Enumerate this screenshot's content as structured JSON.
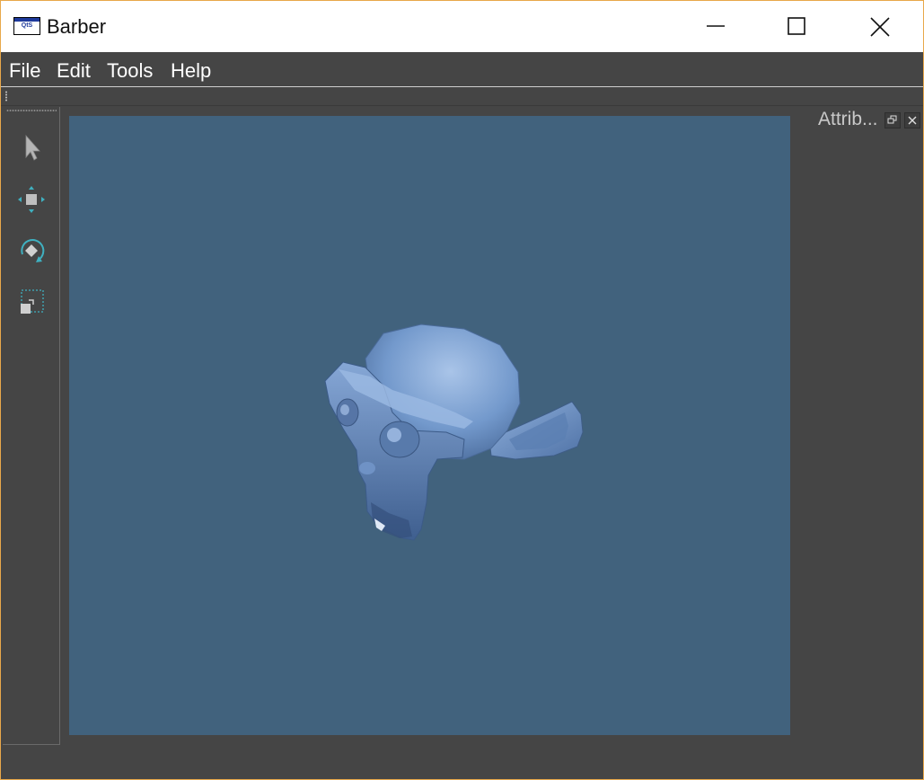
{
  "window": {
    "title": "Barber",
    "app_icon_text": "QtS"
  },
  "menu": {
    "items": [
      {
        "label": "File"
      },
      {
        "label": "Edit"
      },
      {
        "label": "Tools"
      },
      {
        "label": "Help"
      }
    ]
  },
  "tools": [
    {
      "icon": "select-arrow-icon"
    },
    {
      "icon": "move-icon"
    },
    {
      "icon": "rotate-icon"
    },
    {
      "icon": "scale-icon"
    }
  ],
  "attributes_dock": {
    "title": "Attrib..."
  },
  "colors": {
    "window_frame": "#e8a84a",
    "background": "#454545",
    "viewport": "#41627d",
    "mesh": "#6d8fc0",
    "accent": "#3fb0c0"
  }
}
